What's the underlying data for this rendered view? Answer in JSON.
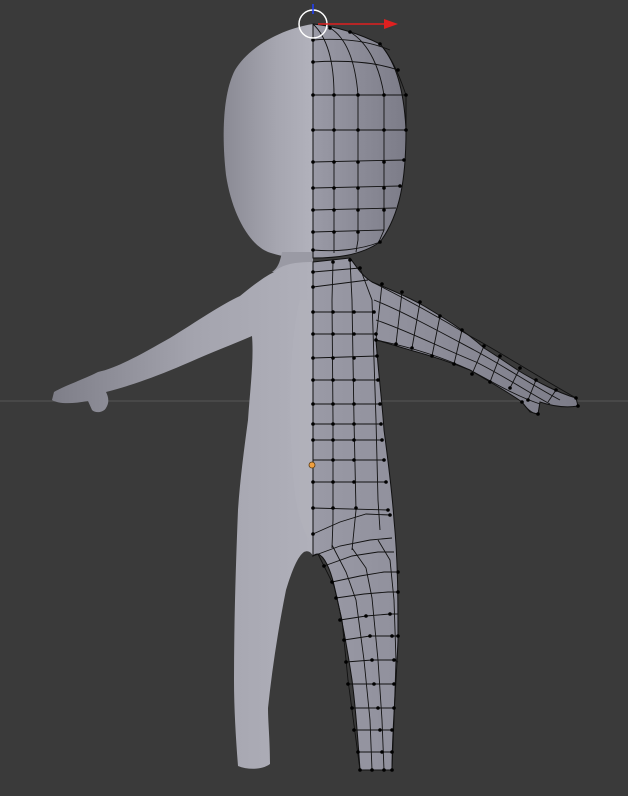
{
  "viewport": {
    "background": "#3a3a3a",
    "horizon_color": "#5a5a5a"
  },
  "model": {
    "shaded_color": "#9c9ca6",
    "mesh_face_color": "#8e8e98",
    "wire_color": "#111111",
    "vertex_color": "#000000",
    "origin_color": "#f0a040"
  },
  "gizmo": {
    "cursor_icon": "3d-cursor-icon",
    "x_axis_color": "#e02020",
    "z_axis_color": "#2040ff"
  }
}
